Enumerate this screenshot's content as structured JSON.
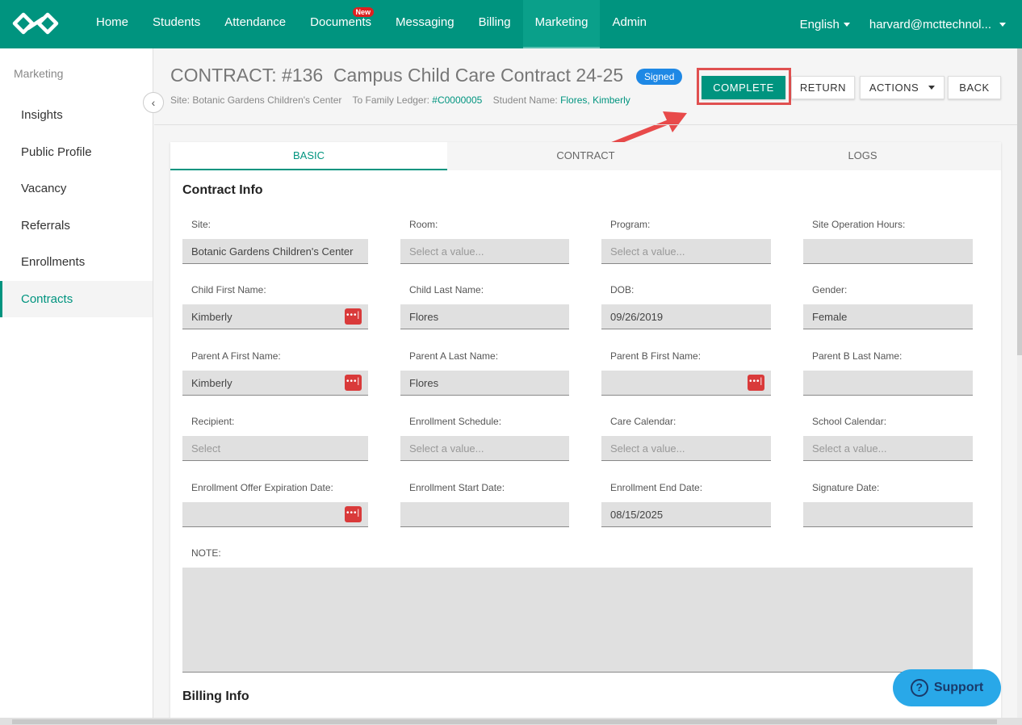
{
  "nav": {
    "items": [
      {
        "label": "Home",
        "active": false
      },
      {
        "label": "Students",
        "active": false
      },
      {
        "label": "Attendance",
        "active": false
      },
      {
        "label": "Documents",
        "active": false
      },
      {
        "label": "Messaging",
        "active": false
      },
      {
        "label": "Billing",
        "active": false
      },
      {
        "label": "Marketing",
        "active": true
      },
      {
        "label": "Admin",
        "active": false
      }
    ],
    "documents_badge": "New",
    "language": "English",
    "user": "harvard@mcttechnol..."
  },
  "sidebar": {
    "section": "Marketing",
    "items": [
      "Insights",
      "Public Profile",
      "Vacancy",
      "Referrals",
      "Enrollments",
      "Contracts"
    ],
    "active": "Contracts"
  },
  "header": {
    "title": "CONTRACT: #136  Campus Child Care Contract 24-25",
    "status": "Signed",
    "site_label": "Site:",
    "site_value": "Botanic Gardens Children's Center",
    "ledger_label": "To Family Ledger:",
    "ledger_value": "#C0000005",
    "student_label": "Student Name:",
    "student_value": "Flores, Kimberly",
    "buttons": {
      "complete": "COMPLETE",
      "return": "RETURN",
      "actions": "ACTIONS",
      "back": "BACK"
    }
  },
  "tabs": [
    "BASIC",
    "CONTRACT",
    "LOGS"
  ],
  "contract_info": {
    "title": "Contract Info",
    "fields": [
      {
        "label": "Site:",
        "value": "Botanic Gardens Children's Center",
        "placeholder": false,
        "dots": false
      },
      {
        "label": "Room:",
        "value": "Select a value...",
        "placeholder": true,
        "dots": false
      },
      {
        "label": "Program:",
        "value": "Select a value...",
        "placeholder": true,
        "dots": false
      },
      {
        "label": "Site Operation Hours:",
        "value": "",
        "placeholder": false,
        "dots": false
      },
      {
        "label": "Child First Name:",
        "value": "Kimberly",
        "placeholder": false,
        "dots": true
      },
      {
        "label": "Child Last Name:",
        "value": "Flores",
        "placeholder": false,
        "dots": false
      },
      {
        "label": "DOB:",
        "value": "09/26/2019",
        "placeholder": false,
        "dots": false
      },
      {
        "label": "Gender:",
        "value": "Female",
        "placeholder": false,
        "dots": false
      },
      {
        "label": "Parent A First Name:",
        "value": "Kimberly",
        "placeholder": false,
        "dots": true
      },
      {
        "label": "Parent A Last Name:",
        "value": "Flores",
        "placeholder": false,
        "dots": false
      },
      {
        "label": "Parent B First Name:",
        "value": "",
        "placeholder": false,
        "dots": true
      },
      {
        "label": "Parent B Last Name:",
        "value": "",
        "placeholder": false,
        "dots": false
      },
      {
        "label": "Recipient:",
        "value": "Select",
        "placeholder": true,
        "dots": false
      },
      {
        "label": "Enrollment Schedule:",
        "value": "Select a value...",
        "placeholder": true,
        "dots": false
      },
      {
        "label": "Care Calendar:",
        "value": "Select a value...",
        "placeholder": true,
        "dots": false
      },
      {
        "label": "School Calendar:",
        "value": "Select a value...",
        "placeholder": true,
        "dots": false
      },
      {
        "label": "Enrollment Offer Expiration Date:",
        "value": "",
        "placeholder": false,
        "dots": true
      },
      {
        "label": "Enrollment Start Date:",
        "value": "",
        "placeholder": false,
        "dots": false
      },
      {
        "label": "Enrollment End Date:",
        "value": "08/15/2025",
        "placeholder": false,
        "dots": false
      },
      {
        "label": "Signature Date:",
        "value": "",
        "placeholder": false,
        "dots": false
      }
    ],
    "note_label": "NOTE:"
  },
  "billing_info": {
    "title": "Billing Info"
  },
  "support": {
    "label": "Support"
  },
  "colors": {
    "brand": "#00947f",
    "signed": "#1e88e5",
    "support": "#29a8e8",
    "annotation": "#e05050"
  }
}
